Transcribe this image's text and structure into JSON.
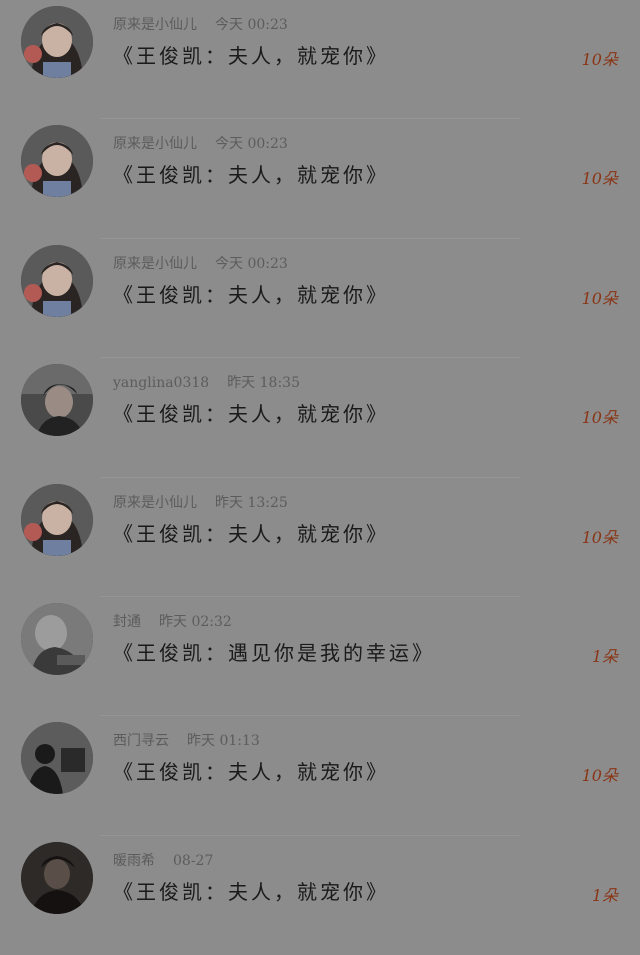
{
  "comments": [
    {
      "avatar": "girl-avatar",
      "username": "原来是小仙儿",
      "time": "今天 00:23",
      "title": "《王俊凯：夫人，就宠你》",
      "count": "10朵"
    },
    {
      "avatar": "girl-avatar",
      "username": "原来是小仙儿",
      "time": "今天 00:23",
      "title": "《王俊凯：夫人，就宠你》",
      "count": "10朵"
    },
    {
      "avatar": "girl-avatar",
      "username": "原来是小仙儿",
      "time": "今天 00:23",
      "title": "《王俊凯：夫人，就宠你》",
      "count": "10朵"
    },
    {
      "avatar": "boy-avatar",
      "username": "yanglina0318",
      "time": "昨天 18:35",
      "title": "《王俊凯：夫人，就宠你》",
      "count": "10朵"
    },
    {
      "avatar": "girl-avatar",
      "username": "原来是小仙儿",
      "time": "昨天 13:25",
      "title": "《王俊凯：夫人，就宠你》",
      "count": "10朵"
    },
    {
      "avatar": "sketch-avatar",
      "username": "封通",
      "time": "昨天 02:32",
      "title": "《王俊凯：遇见你是我的幸运》",
      "count": "1朵"
    },
    {
      "avatar": "silhouette-avatar",
      "username": "西门寻云",
      "time": "昨天 01:13",
      "title": "《王俊凯：夫人，就宠你》",
      "count": "10朵"
    },
    {
      "avatar": "dark-portrait-avatar",
      "username": "暖雨希",
      "time": "08-27",
      "title": "《王俊凯：夫人，就宠你》",
      "count": "1朵"
    }
  ]
}
